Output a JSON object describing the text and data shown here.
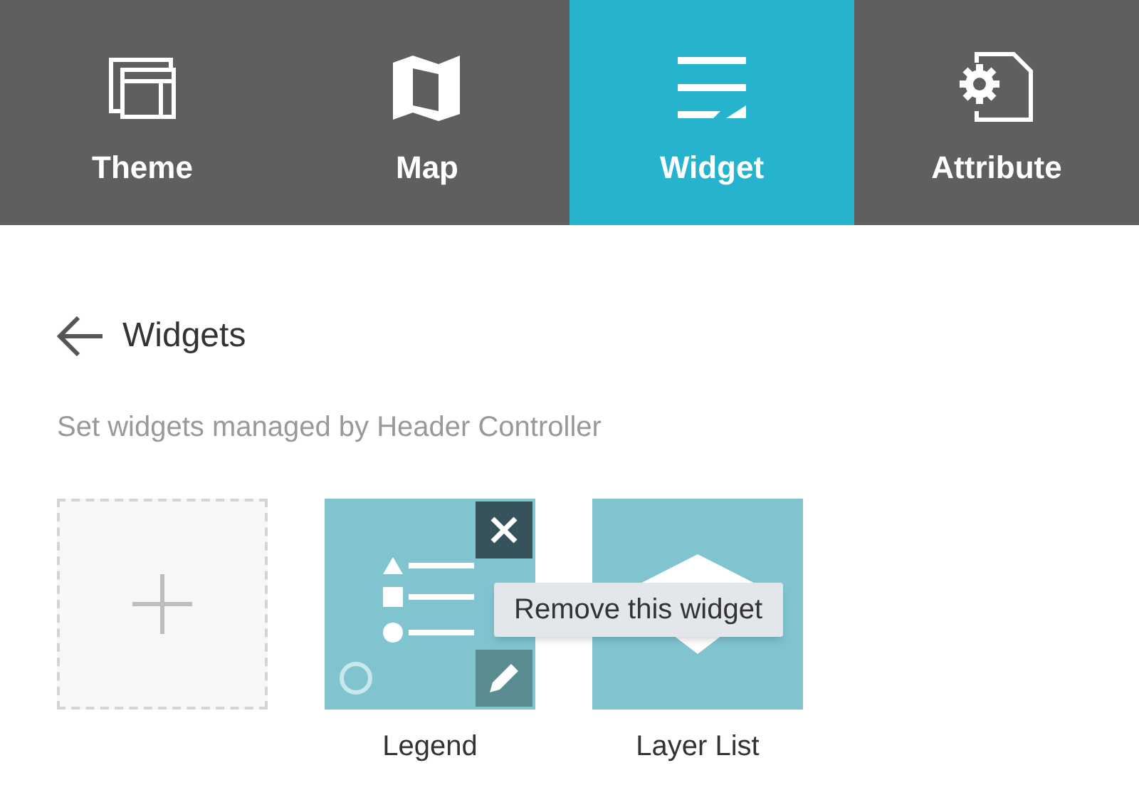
{
  "tabs": [
    {
      "label": "Theme",
      "kind": "theme",
      "selected": false
    },
    {
      "label": "Map",
      "kind": "map",
      "selected": false
    },
    {
      "label": "Widget",
      "kind": "widget",
      "selected": true
    },
    {
      "label": "Attribute",
      "kind": "attribute",
      "selected": false
    }
  ],
  "panel": {
    "title": "Widgets",
    "description": "Set widgets managed by Header Controller"
  },
  "widgets": [
    {
      "kind": "add"
    },
    {
      "kind": "legend",
      "label": "Legend",
      "hovered": true
    },
    {
      "kind": "layer-list",
      "label": "Layer List",
      "hovered": false
    }
  ],
  "tooltip": "Remove this widget"
}
